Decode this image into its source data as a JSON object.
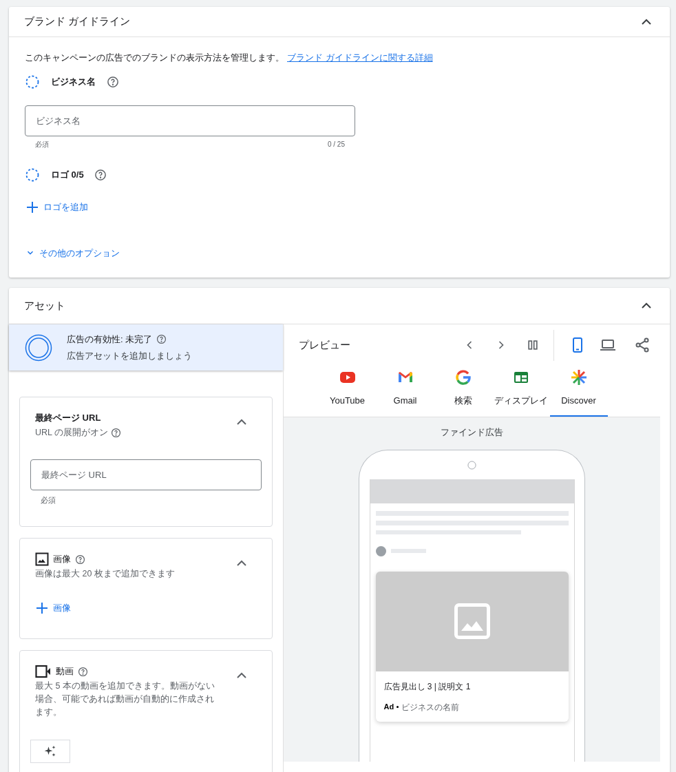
{
  "brand_guidelines": {
    "title": "ブランド ガイドライン",
    "expanded": true,
    "description": "このキャンペーンの広告でのブランドの表示方法を管理します。",
    "link": "ブランド ガイドラインに関する詳細",
    "business_name": {
      "label": "ビジネス名",
      "placeholder": "ビジネス名",
      "hint": "必須",
      "counter": "0 / 25"
    },
    "logo": {
      "label": "ロゴ 0/5",
      "add": "ロゴを追加"
    },
    "more_options": "その他のオプション"
  },
  "assets": {
    "title": "アセット",
    "expanded": true,
    "strength": {
      "label": "広告の有効性: 未完了",
      "message": "広告アセットを追加しましょう"
    },
    "sections": [
      {
        "kind": "url",
        "title": "最終ページ URL",
        "subtitle": "URL の展開がオン",
        "placeholder": "最終ページ URL",
        "hint": "必須",
        "expanded": true
      },
      {
        "kind": "image",
        "title": "画像",
        "subtitle": "画像は最大 20 枚まで追加できます",
        "add": "画像",
        "expanded": true
      },
      {
        "kind": "video",
        "title": "動画",
        "subtitle": "最大 5 本の動画を追加できます。動画がない場合、可能であれば動画が自動的に作成されます。",
        "expanded": true
      }
    ]
  },
  "preview": {
    "title": "プレビュー",
    "devices": [
      {
        "kind": "mobile",
        "selected": true
      },
      {
        "kind": "desktop",
        "selected": false
      }
    ],
    "channels": [
      {
        "kind": "youtube",
        "label": "YouTube",
        "selected": false
      },
      {
        "kind": "gmail",
        "label": "Gmail",
        "selected": false
      },
      {
        "kind": "search",
        "label": "検索",
        "selected": false
      },
      {
        "kind": "display",
        "label": "ディスプレイ",
        "selected": false
      },
      {
        "kind": "discover",
        "label": "Discover",
        "selected": true
      }
    ],
    "format": "ファインド広告",
    "ad": {
      "headline": "広告見出し 3 | 説明文 1",
      "badge": "Ad",
      "business": "ビジネスの名前"
    }
  }
}
